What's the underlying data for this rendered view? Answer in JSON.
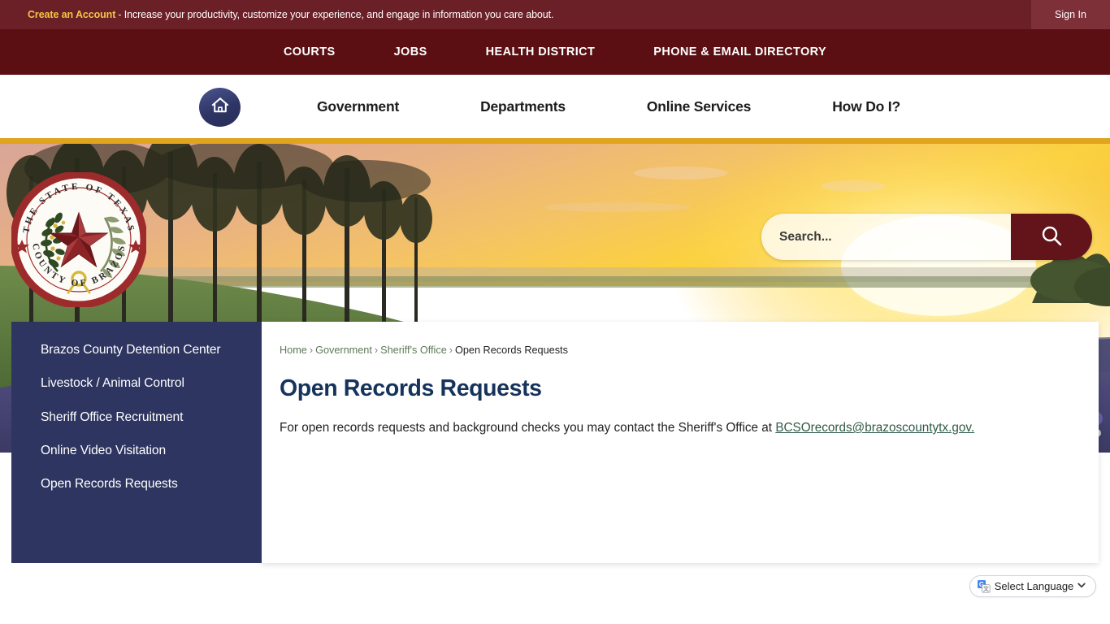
{
  "top_bar": {
    "create_account_label": "Create an Account",
    "tagline": "- Increase your productivity, customize your experience, and engage in information you care about.",
    "sign_in_label": "Sign In",
    "bg_color": "#6b1f27",
    "accent_color": "#f2c744"
  },
  "secondary_nav": {
    "bg_color": "#5c0f12",
    "items": [
      {
        "label": "COURTS"
      },
      {
        "label": "JOBS"
      },
      {
        "label": "HEALTH DISTRICT"
      },
      {
        "label": "PHONE & EMAIL DIRECTORY"
      }
    ]
  },
  "main_nav": {
    "home_icon": "home-icon",
    "home_bg_color": "#2e3565",
    "items": [
      {
        "label": "Government"
      },
      {
        "label": "Departments"
      },
      {
        "label": "Online Services"
      },
      {
        "label": "How Do I?"
      }
    ]
  },
  "gold_bar_color": "#e0a41e",
  "hero": {
    "alt": "Bluebonnet field at sunset with trees",
    "seal": {
      "top_text": "THE STATE OF TEXAS",
      "bottom_text": "COUNTY OF BRAZOS",
      "ring_color": "#9e2b2b",
      "star_color": "#8c2327"
    }
  },
  "search": {
    "placeholder": "Search...",
    "value": "",
    "button_icon": "search-icon",
    "button_color": "#62141a"
  },
  "breadcrumb": {
    "items": [
      {
        "label": "Home",
        "current": false
      },
      {
        "label": "Government",
        "current": false
      },
      {
        "label": "Sheriff's Office",
        "current": false
      },
      {
        "label": "Open Records Requests",
        "current": true
      }
    ],
    "separator": "›"
  },
  "main": {
    "title": "Open Records Requests",
    "paragraph_prefix": "For open records requests and background checks you may contact the Sheriff's Office at ",
    "email_link_label": "BCSOrecords@brazoscountytx.gov.",
    "link_color": "#2f5b46",
    "title_color": "#16335c"
  },
  "sidebar": {
    "bg_color": "#2e3560",
    "items": [
      {
        "label": "Brazos County Detention Center"
      },
      {
        "label": "Livestock / Animal Control"
      },
      {
        "label": "Sheriff Office Recruitment"
      },
      {
        "label": "Online Video Visitation"
      },
      {
        "label": "Open Records Requests"
      }
    ]
  },
  "language_widget": {
    "label": "Select Language",
    "icon": "google-translate-icon",
    "caret_icon": "chevron-down-icon"
  }
}
